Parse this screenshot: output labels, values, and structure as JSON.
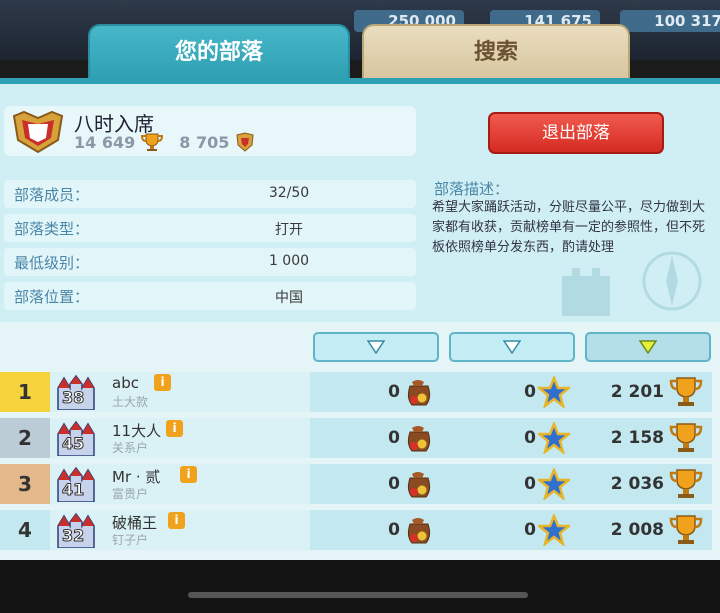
{
  "top_bar": {
    "resource_1": "250 000",
    "resource_2": "141 675",
    "resource_3": "100 317"
  },
  "tabs": {
    "my_clan": "您的部落",
    "search": "搜索"
  },
  "close_glyph": "×",
  "clan": {
    "name": "八时入席",
    "trophies": "14 649",
    "war_points": "8 705",
    "leave_label": "退出部落"
  },
  "info": {
    "members_label": "部落成员：",
    "members_value": "32/50",
    "type_label": "部落类型：",
    "type_value": "打开",
    "min_level_label": "最低级别：",
    "min_level_value": "1 000",
    "location_label": "部落位置：",
    "location_value": "中国"
  },
  "description": {
    "title": "部落描述：",
    "text": "希望大家踊跃活动，分赃尽量公平，尽力做到大家都有收获，贡献榜单有一定的参照性，但不死板依照榜单分发东西，酌请处理"
  },
  "members": [
    {
      "rank": "1",
      "level": "38",
      "name": "abc",
      "role": "土大款",
      "donations": "0",
      "stars": "0",
      "trophies": "2 201",
      "rank_color": "#f6d23c"
    },
    {
      "rank": "2",
      "level": "45",
      "name": "11大人",
      "role": "关系户",
      "donations": "0",
      "stars": "0",
      "trophies": "2 158",
      "rank_color": "#bcccd6"
    },
    {
      "rank": "3",
      "level": "41",
      "name": "Mr · 贰",
      "role": "富贵户",
      "donations": "0",
      "stars": "0",
      "trophies": "2 036",
      "rank_color": "#e3b88a"
    },
    {
      "rank": "4",
      "level": "32",
      "name": "破桶王",
      "role": "钉子户",
      "donations": "0",
      "stars": "0",
      "trophies": "2 008",
      "rank_color": "#c3e8f0"
    }
  ],
  "colors": {
    "panel": "#cfeff4",
    "accent_tab": "#2f9fb2",
    "leave_button": "#d42b22"
  }
}
